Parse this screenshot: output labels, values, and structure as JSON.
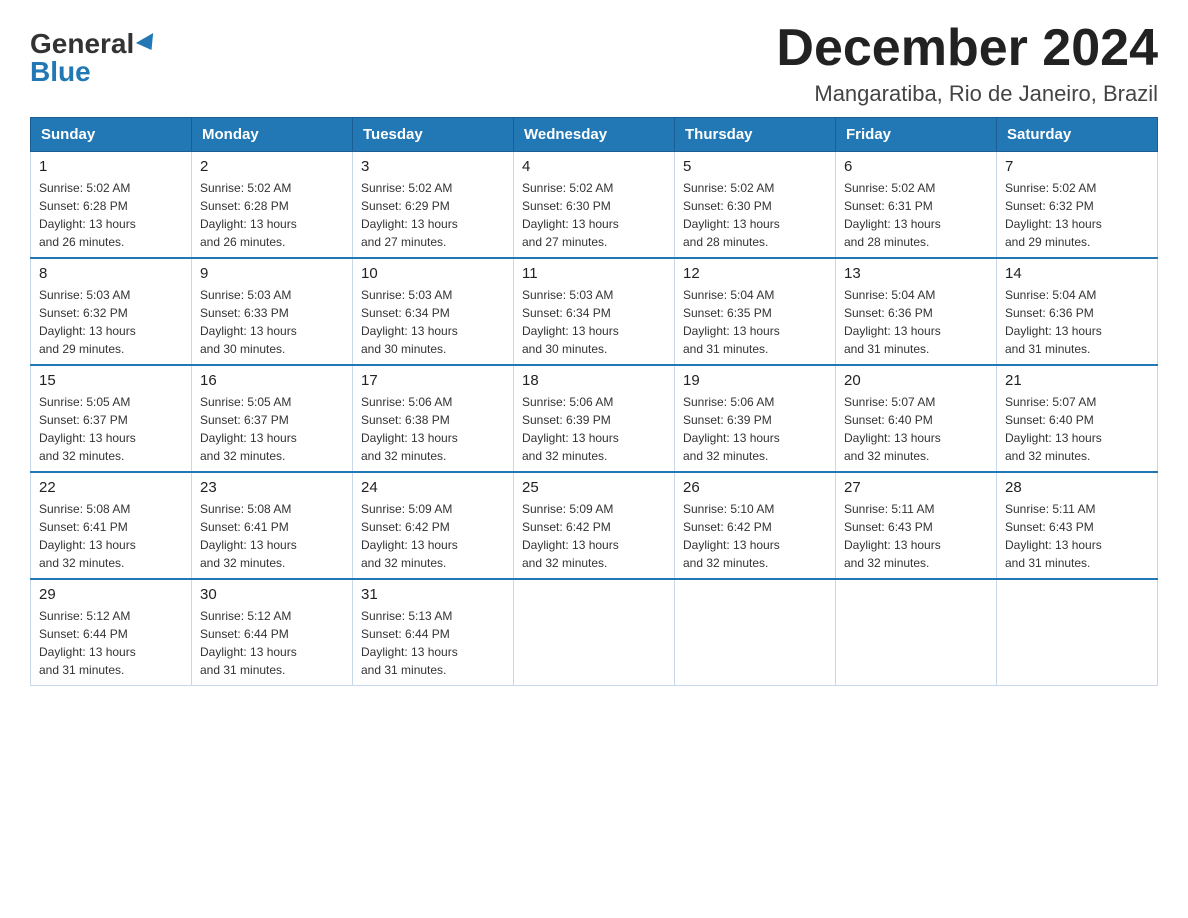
{
  "header": {
    "logo_general": "General",
    "logo_blue": "Blue",
    "month_title": "December 2024",
    "location": "Mangaratiba, Rio de Janeiro, Brazil"
  },
  "days_of_week": [
    "Sunday",
    "Monday",
    "Tuesday",
    "Wednesday",
    "Thursday",
    "Friday",
    "Saturday"
  ],
  "weeks": [
    [
      {
        "day": "1",
        "sunrise": "5:02 AM",
        "sunset": "6:28 PM",
        "daylight": "13 hours and 26 minutes."
      },
      {
        "day": "2",
        "sunrise": "5:02 AM",
        "sunset": "6:28 PM",
        "daylight": "13 hours and 26 minutes."
      },
      {
        "day": "3",
        "sunrise": "5:02 AM",
        "sunset": "6:29 PM",
        "daylight": "13 hours and 27 minutes."
      },
      {
        "day": "4",
        "sunrise": "5:02 AM",
        "sunset": "6:30 PM",
        "daylight": "13 hours and 27 minutes."
      },
      {
        "day": "5",
        "sunrise": "5:02 AM",
        "sunset": "6:30 PM",
        "daylight": "13 hours and 28 minutes."
      },
      {
        "day": "6",
        "sunrise": "5:02 AM",
        "sunset": "6:31 PM",
        "daylight": "13 hours and 28 minutes."
      },
      {
        "day": "7",
        "sunrise": "5:02 AM",
        "sunset": "6:32 PM",
        "daylight": "13 hours and 29 minutes."
      }
    ],
    [
      {
        "day": "8",
        "sunrise": "5:03 AM",
        "sunset": "6:32 PM",
        "daylight": "13 hours and 29 minutes."
      },
      {
        "day": "9",
        "sunrise": "5:03 AM",
        "sunset": "6:33 PM",
        "daylight": "13 hours and 30 minutes."
      },
      {
        "day": "10",
        "sunrise": "5:03 AM",
        "sunset": "6:34 PM",
        "daylight": "13 hours and 30 minutes."
      },
      {
        "day": "11",
        "sunrise": "5:03 AM",
        "sunset": "6:34 PM",
        "daylight": "13 hours and 30 minutes."
      },
      {
        "day": "12",
        "sunrise": "5:04 AM",
        "sunset": "6:35 PM",
        "daylight": "13 hours and 31 minutes."
      },
      {
        "day": "13",
        "sunrise": "5:04 AM",
        "sunset": "6:36 PM",
        "daylight": "13 hours and 31 minutes."
      },
      {
        "day": "14",
        "sunrise": "5:04 AM",
        "sunset": "6:36 PM",
        "daylight": "13 hours and 31 minutes."
      }
    ],
    [
      {
        "day": "15",
        "sunrise": "5:05 AM",
        "sunset": "6:37 PM",
        "daylight": "13 hours and 32 minutes."
      },
      {
        "day": "16",
        "sunrise": "5:05 AM",
        "sunset": "6:37 PM",
        "daylight": "13 hours and 32 minutes."
      },
      {
        "day": "17",
        "sunrise": "5:06 AM",
        "sunset": "6:38 PM",
        "daylight": "13 hours and 32 minutes."
      },
      {
        "day": "18",
        "sunrise": "5:06 AM",
        "sunset": "6:39 PM",
        "daylight": "13 hours and 32 minutes."
      },
      {
        "day": "19",
        "sunrise": "5:06 AM",
        "sunset": "6:39 PM",
        "daylight": "13 hours and 32 minutes."
      },
      {
        "day": "20",
        "sunrise": "5:07 AM",
        "sunset": "6:40 PM",
        "daylight": "13 hours and 32 minutes."
      },
      {
        "day": "21",
        "sunrise": "5:07 AM",
        "sunset": "6:40 PM",
        "daylight": "13 hours and 32 minutes."
      }
    ],
    [
      {
        "day": "22",
        "sunrise": "5:08 AM",
        "sunset": "6:41 PM",
        "daylight": "13 hours and 32 minutes."
      },
      {
        "day": "23",
        "sunrise": "5:08 AM",
        "sunset": "6:41 PM",
        "daylight": "13 hours and 32 minutes."
      },
      {
        "day": "24",
        "sunrise": "5:09 AM",
        "sunset": "6:42 PM",
        "daylight": "13 hours and 32 minutes."
      },
      {
        "day": "25",
        "sunrise": "5:09 AM",
        "sunset": "6:42 PM",
        "daylight": "13 hours and 32 minutes."
      },
      {
        "day": "26",
        "sunrise": "5:10 AM",
        "sunset": "6:42 PM",
        "daylight": "13 hours and 32 minutes."
      },
      {
        "day": "27",
        "sunrise": "5:11 AM",
        "sunset": "6:43 PM",
        "daylight": "13 hours and 32 minutes."
      },
      {
        "day": "28",
        "sunrise": "5:11 AM",
        "sunset": "6:43 PM",
        "daylight": "13 hours and 31 minutes."
      }
    ],
    [
      {
        "day": "29",
        "sunrise": "5:12 AM",
        "sunset": "6:44 PM",
        "daylight": "13 hours and 31 minutes."
      },
      {
        "day": "30",
        "sunrise": "5:12 AM",
        "sunset": "6:44 PM",
        "daylight": "13 hours and 31 minutes."
      },
      {
        "day": "31",
        "sunrise": "5:13 AM",
        "sunset": "6:44 PM",
        "daylight": "13 hours and 31 minutes."
      },
      null,
      null,
      null,
      null
    ]
  ],
  "labels": {
    "sunrise": "Sunrise:",
    "sunset": "Sunset:",
    "daylight": "Daylight:"
  }
}
